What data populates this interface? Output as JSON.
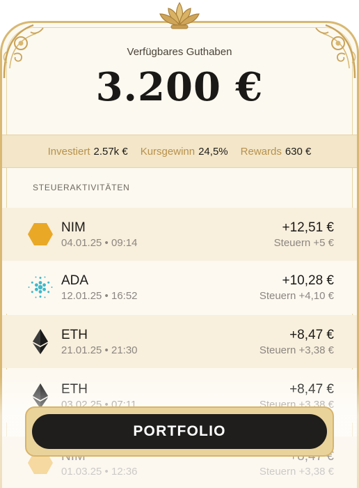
{
  "balance": {
    "label": "Verfügbares Guthaben",
    "value": "3.200 €"
  },
  "stats": [
    {
      "label": "Investiert",
      "value": "2.57k €"
    },
    {
      "label": "Kursgewinn",
      "value": "24,5%"
    },
    {
      "label": "Rewards",
      "value": "630 €"
    }
  ],
  "section_title": "STEUERAKTIVITÄTEN",
  "activities": [
    {
      "coin": "NIM",
      "icon": "nimiq-hexagon-icon",
      "datetime": "04.01.25 • 09:14",
      "amount": "+12,51 €",
      "tax": "Steuern +5 €"
    },
    {
      "coin": "ADA",
      "icon": "cardano-icon",
      "datetime": "12.01.25 • 16:52",
      "amount": "+10,28 €",
      "tax": "Steuern +4,10 €"
    },
    {
      "coin": "ETH",
      "icon": "ethereum-icon",
      "datetime": "21.01.25 • 21:30",
      "amount": "+8,47 €",
      "tax": "Steuern +3,38 €"
    },
    {
      "coin": "ETH",
      "icon": "ethereum-icon",
      "datetime": "03.02.25 • 07:11",
      "amount": "+8,47 €",
      "tax": "Steuern +3,38 €"
    },
    {
      "coin": "NIM",
      "icon": "nimiq-hexagon-icon",
      "datetime": "01.03.25 • 12:36",
      "amount": "+8,47 €",
      "tax": "Steuern +3,38 €"
    }
  ],
  "portfolio_button": "PORTFOLIO",
  "colors": {
    "gold": "#d8b872",
    "stats_bg": "#f3e6c9",
    "nim_orange": "#e9a825",
    "ada_teal": "#3fb8c9",
    "button_dark": "#1f1e1c"
  }
}
